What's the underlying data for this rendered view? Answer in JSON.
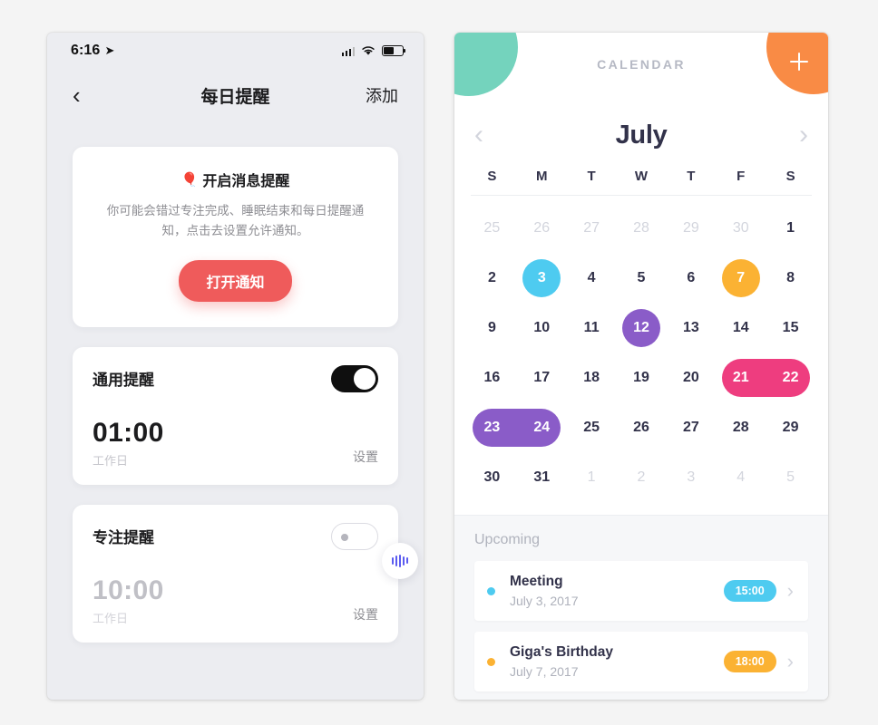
{
  "left_phone": {
    "status": {
      "time": "6:16",
      "location_icon": "location-arrow-icon",
      "signal_icon": "cellular-signal-icon",
      "wifi_icon": "wifi-icon",
      "battery_icon": "battery-icon"
    },
    "nav": {
      "back_icon": "chevron-left-icon",
      "title": "每日提醒",
      "action": "添加"
    },
    "notify_card": {
      "emoji": "🎈",
      "title": "开启消息提醒",
      "description": "你可能会错过专注完成、睡眠结束和每日提醒通知，点击去设置允许通知。",
      "button": "打开通知",
      "button_color": "#ef5b5b"
    },
    "reminders": [
      {
        "name": "通用提醒",
        "toggle_state": "on",
        "time": "01:00",
        "subtitle": "工作日",
        "action": "设置",
        "enabled": true
      },
      {
        "name": "专注提醒",
        "toggle_state": "off",
        "time": "10:00",
        "subtitle": "工作日",
        "action": "设置",
        "enabled": false,
        "floating_icon": "audio-waveform-icon"
      }
    ]
  },
  "right_phone": {
    "header": {
      "menu_icon": "hamburger-menu-icon",
      "menu_color": "#74d3bd",
      "kicker": "CALENDAR",
      "add_icon": "plus-icon",
      "add_color": "#f98b45"
    },
    "month": {
      "prev_icon": "chevron-left-icon",
      "name": "July",
      "next_icon": "chevron-right-icon"
    },
    "weekdays": [
      "S",
      "M",
      "T",
      "W",
      "T",
      "F",
      "S"
    ],
    "days": [
      {
        "n": "25",
        "muted": true
      },
      {
        "n": "26",
        "muted": true
      },
      {
        "n": "27",
        "muted": true
      },
      {
        "n": "28",
        "muted": true
      },
      {
        "n": "29",
        "muted": true
      },
      {
        "n": "30",
        "muted": true
      },
      {
        "n": "1"
      },
      {
        "n": "2"
      },
      {
        "n": "3",
        "hl": "circ",
        "color": "#4ecbf0"
      },
      {
        "n": "4"
      },
      {
        "n": "5"
      },
      {
        "n": "6"
      },
      {
        "n": "7",
        "hl": "circ",
        "color": "#fbb233"
      },
      {
        "n": "8"
      },
      {
        "n": "9"
      },
      {
        "n": "10"
      },
      {
        "n": "11"
      },
      {
        "n": "12",
        "hl": "circ",
        "color": "#8a5cc8"
      },
      {
        "n": "13"
      },
      {
        "n": "14"
      },
      {
        "n": "15"
      },
      {
        "n": "16"
      },
      {
        "n": "17"
      },
      {
        "n": "18"
      },
      {
        "n": "19"
      },
      {
        "n": "20"
      },
      {
        "n": "21",
        "hl": "start",
        "color": "#ee3d7f"
      },
      {
        "n": "22",
        "hl": "end",
        "color": "#ee3d7f"
      },
      {
        "n": "23",
        "hl": "start",
        "color": "#8a5cc8"
      },
      {
        "n": "24",
        "hl": "end",
        "color": "#8a5cc8"
      },
      {
        "n": "25"
      },
      {
        "n": "26"
      },
      {
        "n": "27"
      },
      {
        "n": "28"
      },
      {
        "n": "29"
      },
      {
        "n": "30"
      },
      {
        "n": "31"
      },
      {
        "n": "1",
        "muted": true
      },
      {
        "n": "2",
        "muted": true
      },
      {
        "n": "3",
        "muted": true
      },
      {
        "n": "4",
        "muted": true
      },
      {
        "n": "5",
        "muted": true
      }
    ],
    "upcoming": {
      "title": "Upcoming",
      "events": [
        {
          "name": "Meeting",
          "date": "July 3, 2017",
          "time": "15:00",
          "color": "#4ecbf0",
          "chevron_icon": "chevron-right-icon"
        },
        {
          "name": "Giga's Birthday",
          "date": "July 7, 2017",
          "time": "18:00",
          "color": "#fbb233",
          "chevron_icon": "chevron-right-icon"
        }
      ]
    }
  }
}
